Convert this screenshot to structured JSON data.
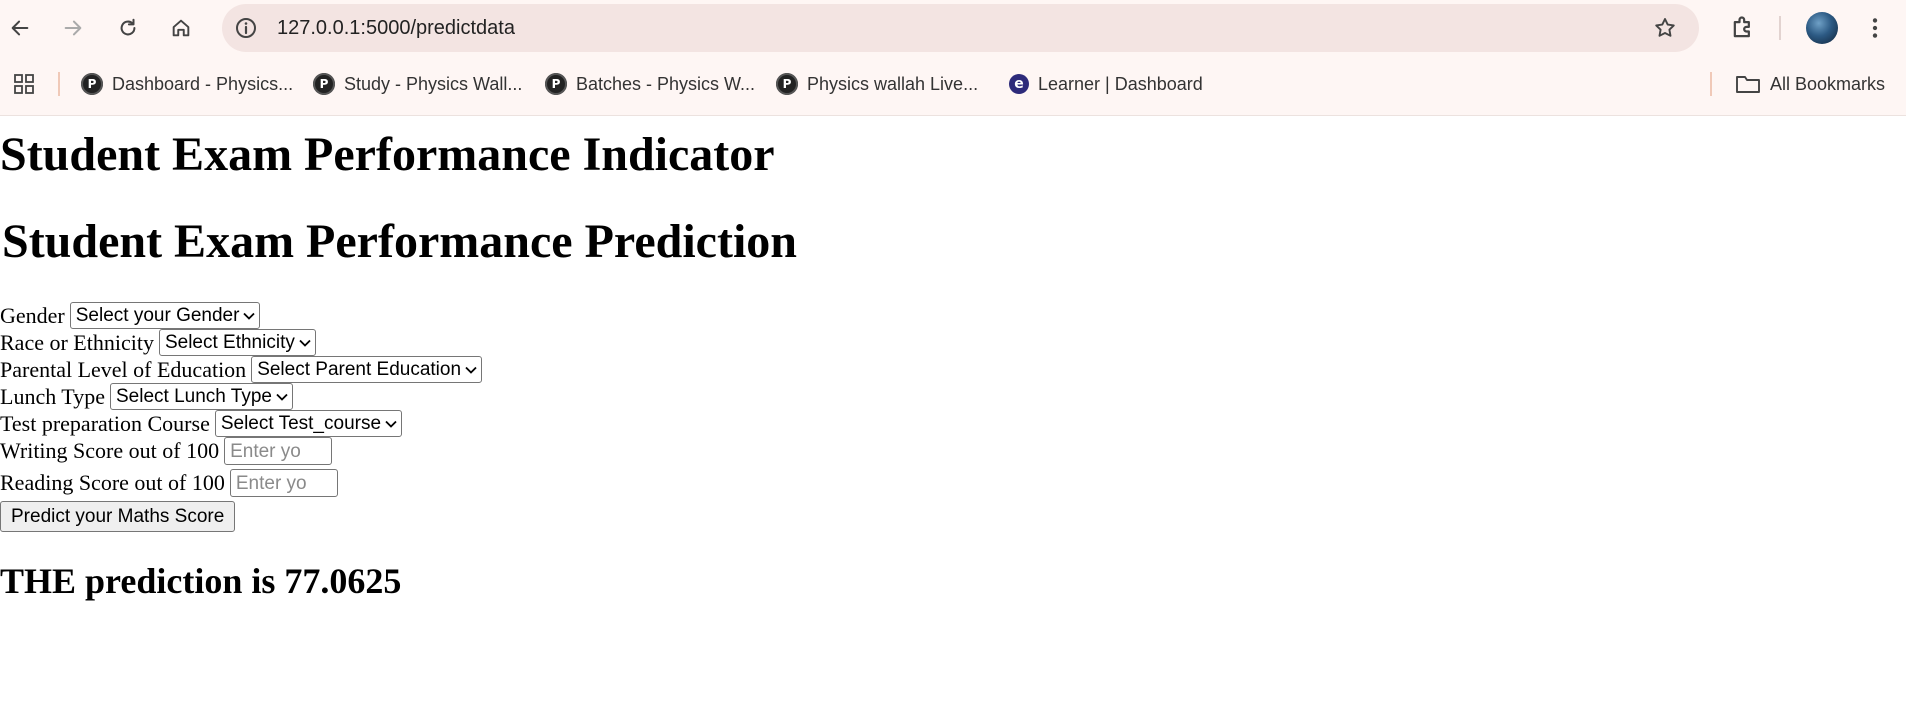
{
  "browser": {
    "url": "127.0.0.1:5000/predictdata",
    "bookmarks": [
      {
        "label": "Dashboard - Physics...",
        "icon": "physics-wallah-icon"
      },
      {
        "label": "Study - Physics Wall...",
        "icon": "physics-wallah-icon"
      },
      {
        "label": "Batches - Physics W...",
        "icon": "physics-wallah-icon"
      },
      {
        "label": "Physics wallah Live...",
        "icon": "physics-wallah-icon"
      },
      {
        "label": "Learner | Dashboard",
        "icon": "learner-e-icon"
      }
    ],
    "all_bookmarks_label": "All Bookmarks"
  },
  "page": {
    "heading": "Student Exam Performance Indicator",
    "form_heading": "Student Exam Performance Prediction",
    "fields": {
      "gender": {
        "label": "Gender",
        "selected": "Select your Gender"
      },
      "ethnicity": {
        "label": "Race or Ethnicity",
        "selected": "Select Ethnicity"
      },
      "parent_education": {
        "label": "Parental Level of Education",
        "selected": "Select Parent Education"
      },
      "lunch": {
        "label": "Lunch Type",
        "selected": "Select Lunch Type"
      },
      "test_course": {
        "label": "Test preparation Course",
        "selected": "Select Test_course"
      },
      "writing": {
        "label": "Writing Score out of 100",
        "placeholder": "Enter yo"
      },
      "reading": {
        "label": "Reading Score out of 100",
        "placeholder": "Enter yo"
      }
    },
    "submit_label": "Predict your Maths Score",
    "result": "THE prediction is 77.0625"
  }
}
